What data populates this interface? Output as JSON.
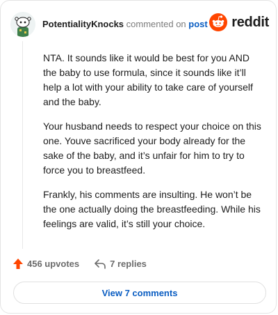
{
  "header": {
    "username": "PotentialityKnocks",
    "action_text": "commented on",
    "post_link": "post",
    "brand": "reddit",
    "avatar_icon": "snoo-avatar-icon",
    "brand_icon": "reddit-logo-icon",
    "brand_color": "#ff4500"
  },
  "comment": {
    "paragraphs": [
      "NTA. It sounds like it would be best for you AND the baby to use formula, since it sounds like it’ll help a lot with your ability to take care of yourself and the baby.",
      "Your husband needs to respect your choice on this one. Youve sacrificed your body already for the sake of the baby, and it’s unfair for him to try to force you to breastfeed.",
      "Frankly, his comments are insulting. He won’t be the one actually doing the breastfeeding. While his feelings are valid, it’s still your choice."
    ]
  },
  "footer": {
    "upvotes": "456 upvotes",
    "replies": "7 replies",
    "upvote_icon": "upvote-arrow-icon",
    "reply_icon": "reply-arrow-icon",
    "upvote_color": "#ff4500"
  },
  "view_comments": "View 7 comments",
  "colors": {
    "link": "#0a5dc2",
    "muted": "#7c7c7c",
    "border": "#e4e4e4"
  }
}
